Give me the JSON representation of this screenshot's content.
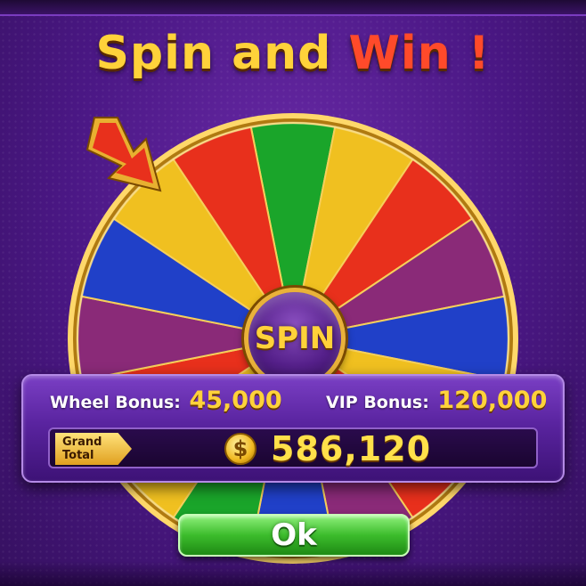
{
  "title": {
    "part1": "Spin and",
    "part2": "Win !"
  },
  "wheel": {
    "spin_label": "SPIN",
    "segment_colors": [
      "#1aa52a",
      "#f0c020",
      "#e8301c",
      "#8a2a78",
      "#2040c8",
      "#f0c020",
      "#e8301c",
      "#8a2a78",
      "#2040c8",
      "#1aa52a",
      "#f0c020",
      "#e8301c",
      "#8a2a78",
      "#2040c8",
      "#f0c020",
      "#e8301c"
    ]
  },
  "panel": {
    "wheel_bonus_label": "Wheel Bonus:",
    "wheel_bonus_value": "45,000",
    "vip_bonus_label": "VIP Bonus:",
    "vip_bonus_value": "120,000",
    "grand_total_label_1": "Grand",
    "grand_total_label_2": "Total",
    "coin_symbol": "$",
    "grand_total_value": "586,120"
  },
  "ok_button": {
    "label": "Ok"
  },
  "icons": {
    "pointer": "arrow-pointer-icon",
    "coin": "dollar-coin-icon"
  }
}
